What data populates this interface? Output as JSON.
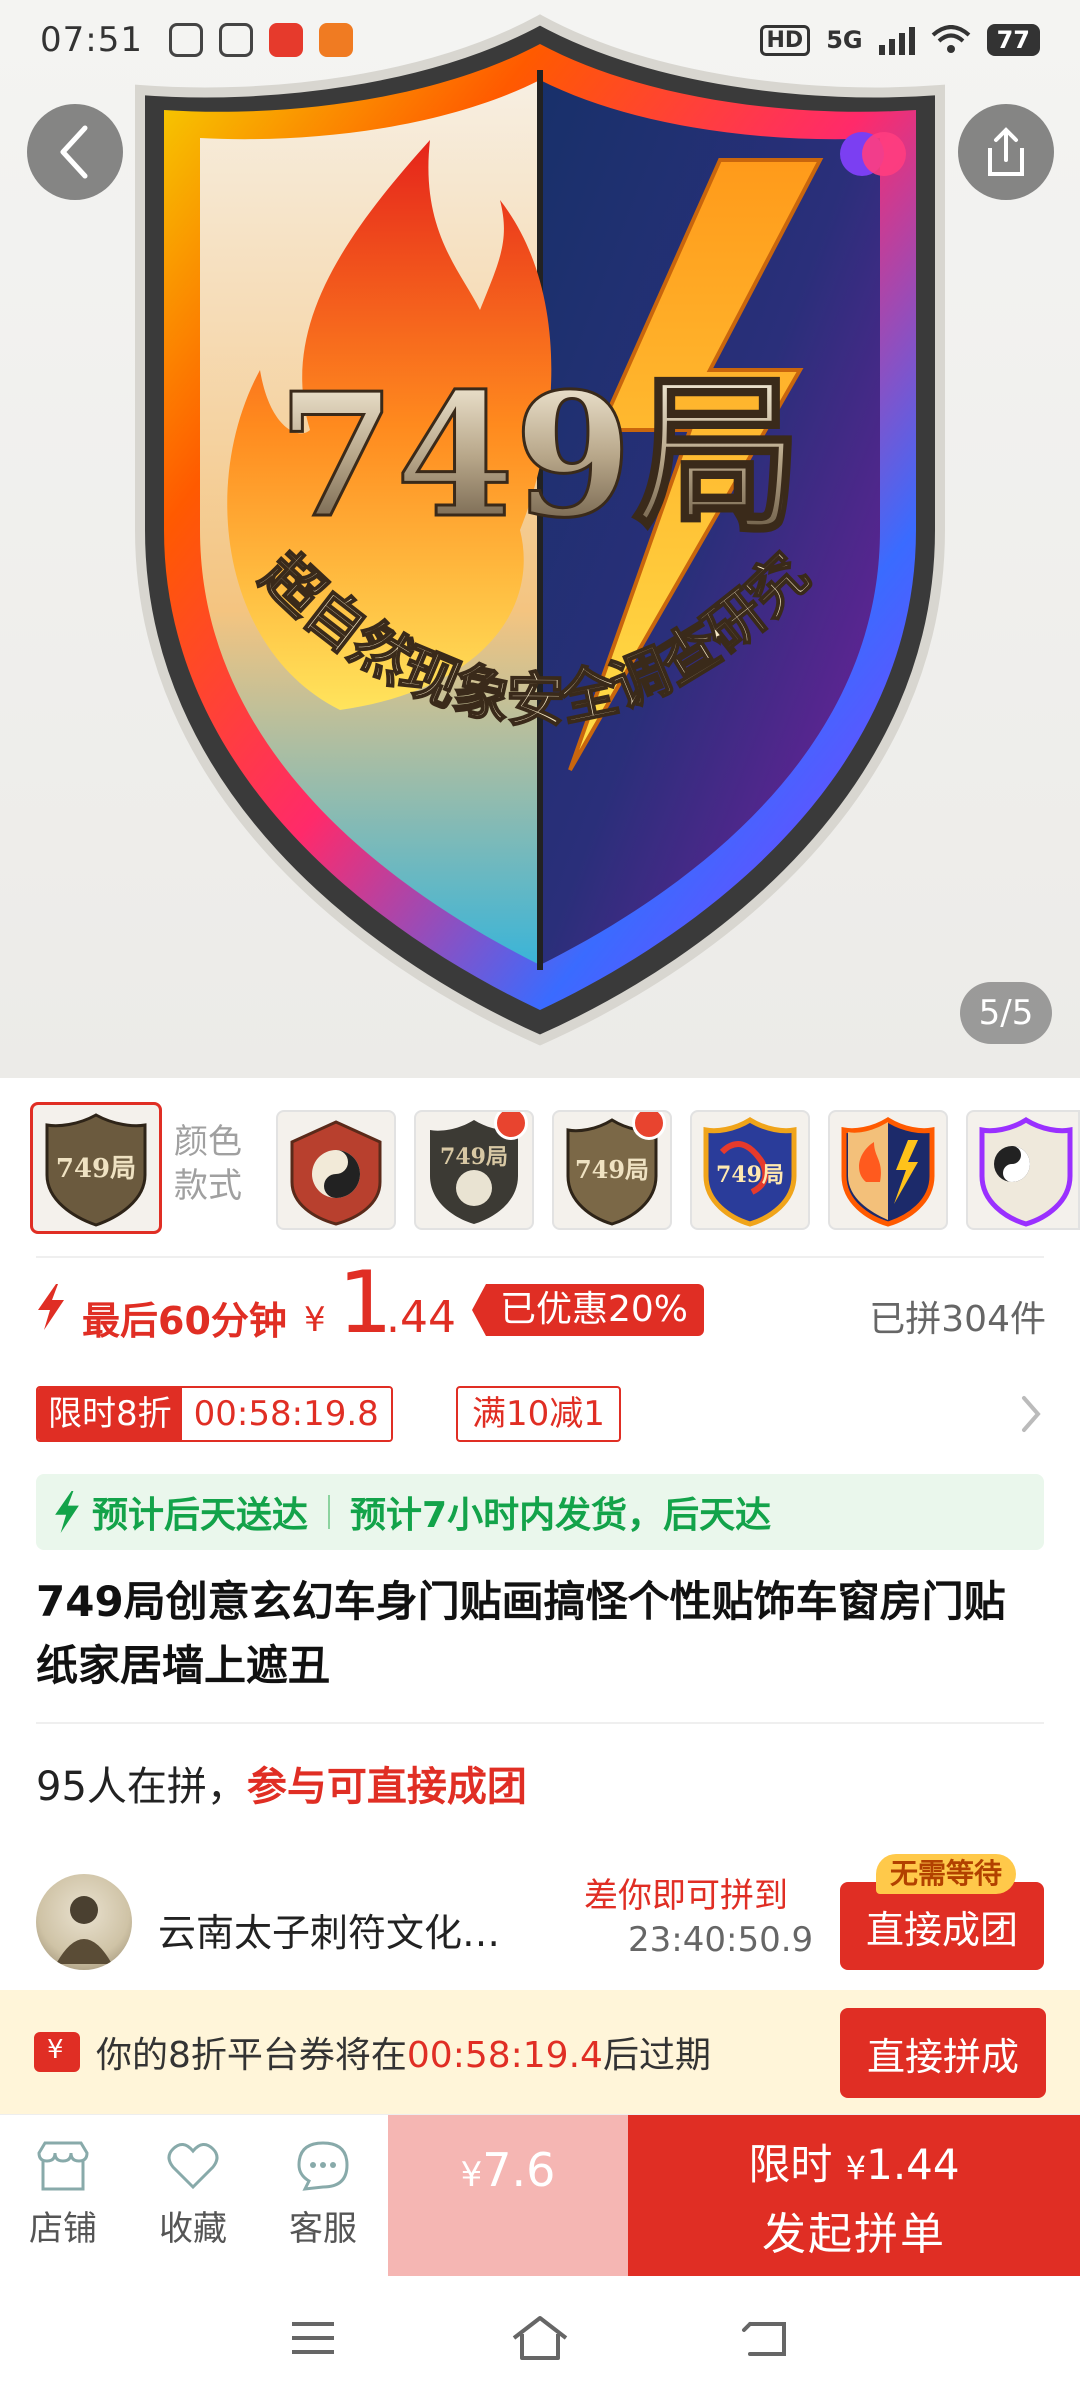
{
  "status_bar": {
    "time": "07:51",
    "network": "5G",
    "hd": "HD",
    "battery": "77"
  },
  "hero": {
    "page_counter": "5/5",
    "image_text": {
      "headline": "749局",
      "tagline": "超自然现象安全调查研究"
    },
    "icons": {
      "back": "chevron-left-icon",
      "share": "share-icon"
    }
  },
  "variants": {
    "label_line1": "颜色",
    "label_line2": "款式",
    "thumb_count": 7
  },
  "price": {
    "countdown_text": "最后60分钟",
    "currency": "¥",
    "integer": "1",
    "decimal": ".44",
    "discount": "已优惠20%",
    "sold": "已拼304件"
  },
  "promo": {
    "tag_label": "限时8折",
    "tag_timer": "00:58:19.8",
    "coupon": "满10减1"
  },
  "delivery": {
    "primary": "预计后天送达",
    "secondary": "预计7小时内发货，后天达"
  },
  "product": {
    "title": "749局创意玄幻车身门贴画搞怪个性贴饰车窗房门贴纸家居墙上遮丑"
  },
  "group": {
    "count_text": "95人在拼，",
    "highlight": "参与可直接成团",
    "member_name": "云南太子刺符文化…",
    "gap_label": "差你即可拼到",
    "gap_timer": "23:40:50.9",
    "join_button": "直接成团",
    "no_wait_badge": "无需等待"
  },
  "coupon_bar": {
    "prefix": "你的8折平台券将在",
    "timer": "00:58:19.4",
    "suffix": "后过期",
    "button": "直接拼成"
  },
  "action_bar": {
    "store": "店铺",
    "favorite": "收藏",
    "service": "客服",
    "single_currency": "¥",
    "single_price": "7.6",
    "group_line1_prefix": "限时",
    "group_currency": "¥",
    "group_price": "1.44",
    "group_line2": "发起拼单"
  },
  "colors": {
    "accent": "#e02e24",
    "delivery_green": "#13a34a",
    "delivery_bg": "#eaf7ec",
    "coupon_bg": "#fff5d9"
  }
}
